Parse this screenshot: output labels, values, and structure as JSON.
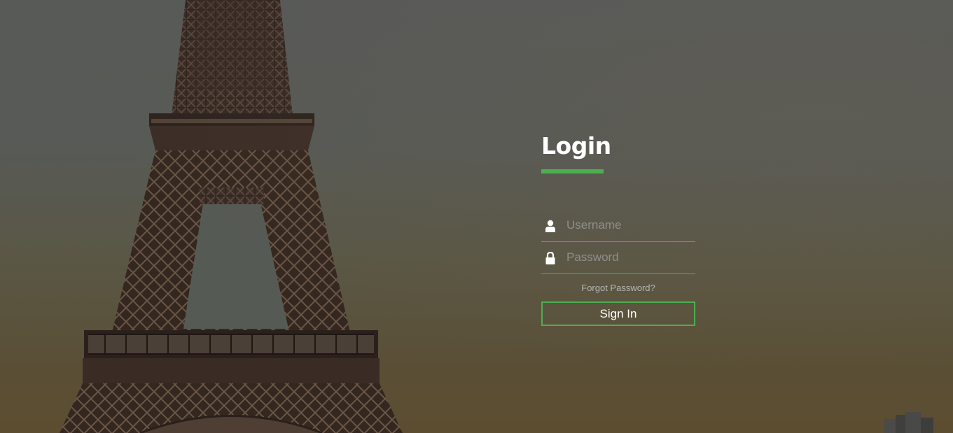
{
  "login": {
    "title": "Login",
    "accent_color": "#4caf50",
    "username": {
      "placeholder": "Username",
      "value": "",
      "icon": "user-icon"
    },
    "password": {
      "placeholder": "Password",
      "value": "",
      "icon": "lock-icon"
    },
    "forgot_label": "Forgot Password?",
    "signin_label": "Sign In"
  },
  "background": {
    "image": "eiffel-tower-photo"
  }
}
